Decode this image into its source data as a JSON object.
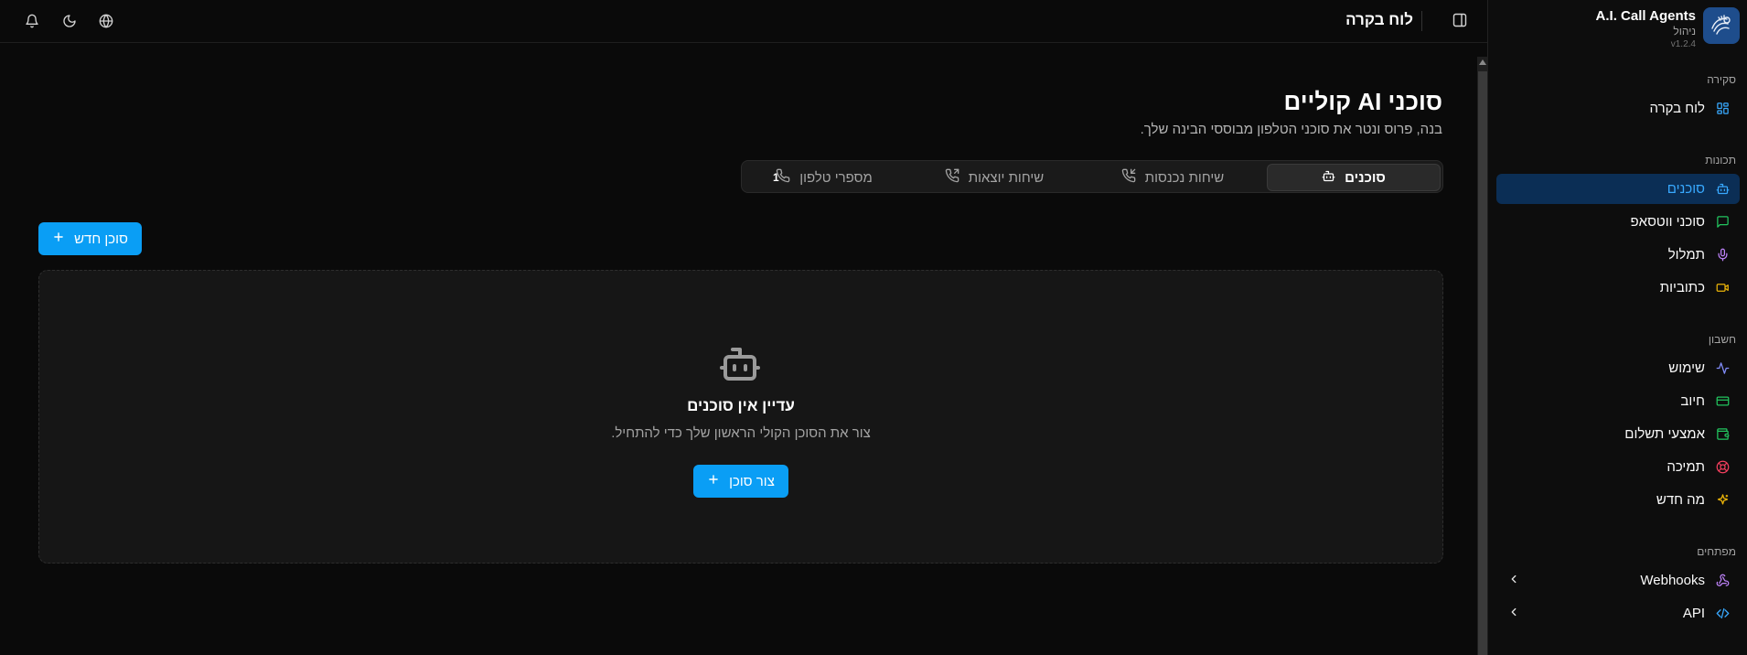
{
  "brand": {
    "title": "A.I. Call Agents",
    "subtitle": "ניהול",
    "version": "v1.2.4"
  },
  "sidebar": {
    "sections": [
      {
        "label": "סקירה",
        "items": [
          {
            "label": "לוח בקרה",
            "icon": "dashboard-icon"
          }
        ]
      },
      {
        "label": "תכונות",
        "items": [
          {
            "label": "סוכנים",
            "icon": "bot-icon",
            "active": true
          },
          {
            "label": "סוכני ווטסאפ",
            "icon": "message-icon"
          },
          {
            "label": "תמלול",
            "icon": "mic-icon"
          },
          {
            "label": "כתוביות",
            "icon": "video-icon"
          }
        ]
      },
      {
        "label": "חשבון",
        "items": [
          {
            "label": "שימוש",
            "icon": "activity-icon"
          },
          {
            "label": "חיוב",
            "icon": "credit-card-icon"
          },
          {
            "label": "אמצעי תשלום",
            "icon": "wallet-icon"
          },
          {
            "label": "תמיכה",
            "icon": "lifebuoy-icon"
          },
          {
            "label": "מה חדש",
            "icon": "sparkles-icon"
          }
        ]
      },
      {
        "label": "מפתחים",
        "items": [
          {
            "label": "Webhooks",
            "icon": "webhook-icon"
          },
          {
            "label": "API",
            "icon": "code-icon"
          }
        ]
      }
    ]
  },
  "topbar": {
    "title": "לוח בקרה"
  },
  "main": {
    "title": "סוכני AI קוליים",
    "subtitle": "בנה, פרוס ונטר את סוכני הטלפון מבוססי הבינה שלך.",
    "tabs": [
      {
        "label": "סוכנים",
        "icon": "bot-icon",
        "active": true
      },
      {
        "label": "שיחות נכנסות",
        "icon": "phone-incoming-icon"
      },
      {
        "label": "שיחות יוצאות",
        "icon": "phone-outgoing-icon"
      },
      {
        "label": "מספרי טלפון",
        "icon": "phone-icon",
        "count": "1"
      }
    ],
    "new_agent_label": "סוכן חדש",
    "empty": {
      "title": "עדיין אין סוכנים",
      "subtitle": "צור את הסוכן הקולי הראשון שלך כדי להתחיל.",
      "cta_label": "צור סוכן"
    }
  },
  "colors": {
    "accent": "#0a9ef5",
    "active_nav_bg": "#0b2e55",
    "active_nav_text": "#38a9ff",
    "background": "#0a0a0a"
  }
}
